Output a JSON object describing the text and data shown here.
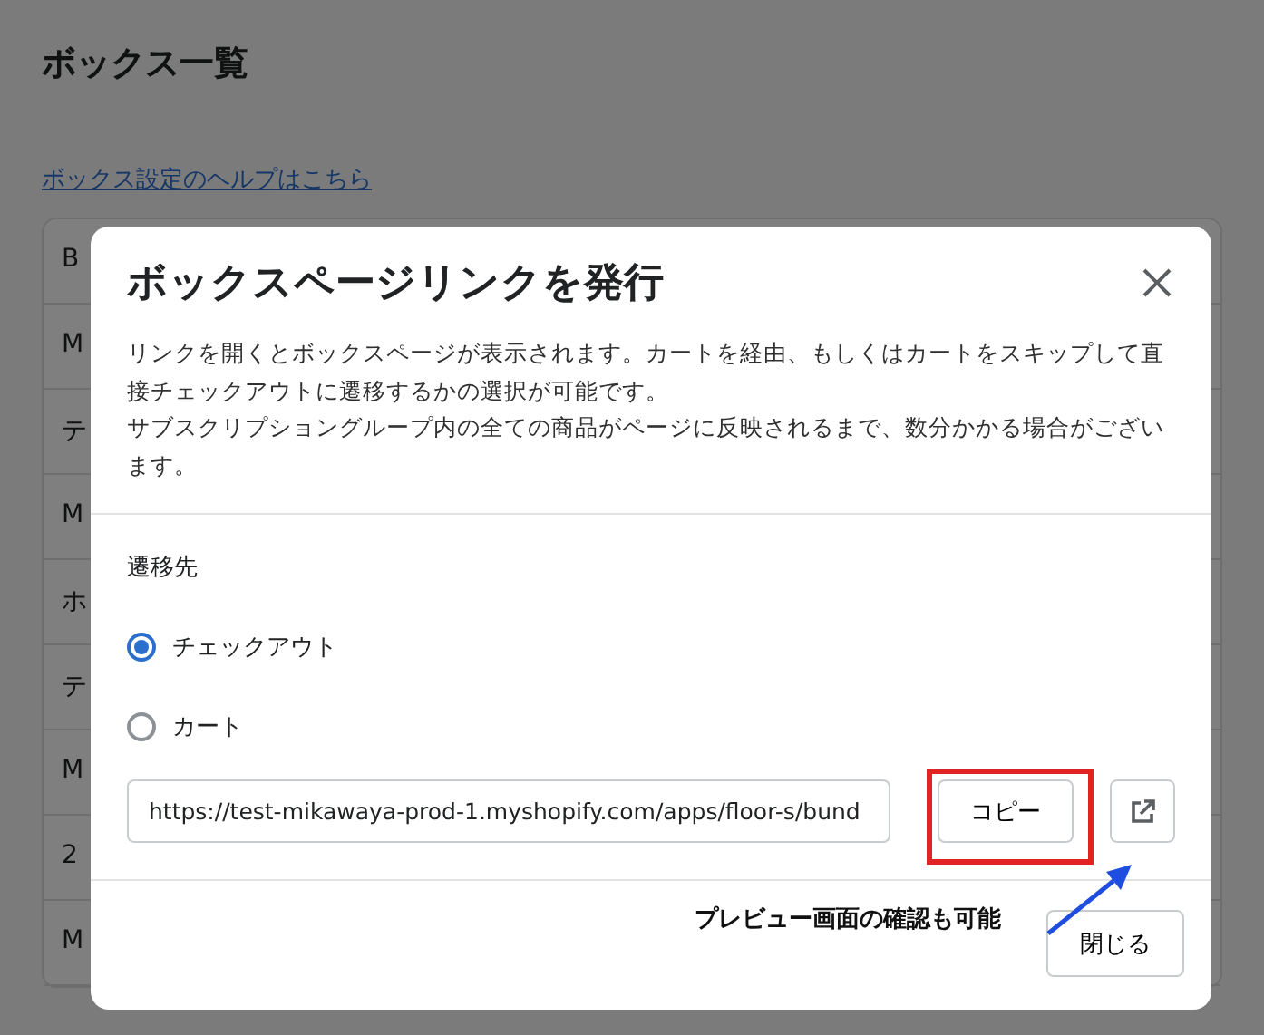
{
  "page": {
    "title": "ボックス一覧",
    "help_link": "ボックス設定のヘルプはこちら",
    "rows": [
      "B",
      "M",
      "テ",
      "M",
      "ホ",
      "テ",
      "M",
      "2",
      "M"
    ]
  },
  "modal": {
    "title": "ボックスページリンクを発行",
    "description": [
      "リンクを開くとボックスページが表示されます。カートを経由、もしくはカートをスキップして直接チェックアウトに遷移するかの選択が可能です。",
      "サブスクリプショングループ内の全ての商品がページに反映されるまで、数分かかる場合がございます。"
    ],
    "destination_label": "遷移先",
    "options": [
      {
        "label": "チェックアウト",
        "selected": true
      },
      {
        "label": "カート",
        "selected": false
      }
    ],
    "url": "https://test-mikawaya-prod-1.myshopify.com/apps/floor-s/bund",
    "copy_button": "コピー",
    "close_button": "閉じる"
  },
  "annotation": {
    "text": "プレビュー画面の確認も可能"
  }
}
